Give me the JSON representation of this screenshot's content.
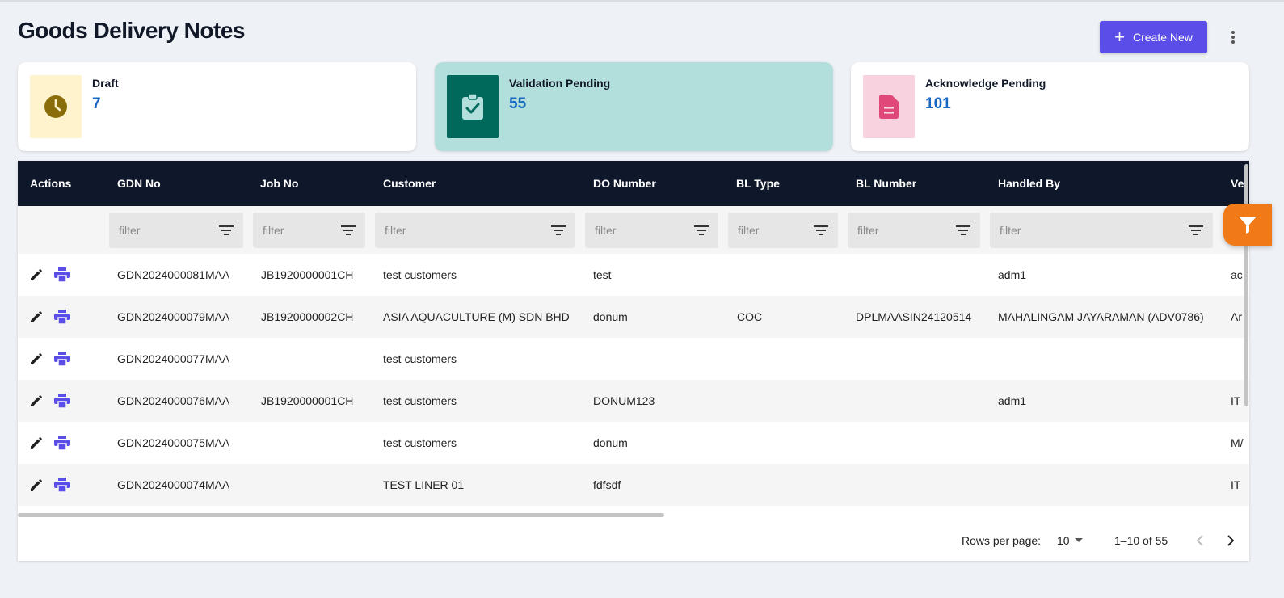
{
  "page": {
    "title": "Goods Delivery Notes"
  },
  "header": {
    "create_label": "Create New"
  },
  "summary_cards": [
    {
      "label": "Draft",
      "count": "7",
      "icon": "clock-icon",
      "icon_bg": "#fff3cd",
      "icon_color": "#8a6d0b"
    },
    {
      "label": "Validation Pending",
      "count": "55",
      "icon": "clipboard-check-icon",
      "icon_bg": "#00695c",
      "icon_color": "#b2dfdb"
    },
    {
      "label": "Acknowledge Pending",
      "count": "101",
      "icon": "document-icon",
      "icon_bg": "#f8d3df",
      "icon_color": "#e0487a"
    }
  ],
  "table": {
    "columns": [
      "Actions",
      "GDN No",
      "Job No",
      "Customer",
      "DO Number",
      "BL Type",
      "BL Number",
      "Handled By",
      "Ve"
    ],
    "filter_placeholder": "filter",
    "rows": [
      {
        "gdn": "GDN2024000081MAA",
        "job": "JB1920000001CH",
        "customer": "test customers",
        "do": "test",
        "bl_type": "",
        "bl_number": "",
        "handled_by": "adm1",
        "ve": "ac"
      },
      {
        "gdn": "GDN2024000079MAA",
        "job": "JB1920000002CH",
        "customer": "ASIA AQUACULTURE (M) SDN BHD",
        "do": "donum",
        "bl_type": "COC",
        "bl_number": "DPLMAASIN24120514",
        "handled_by": "MAHALINGAM JAYARAMAN (ADV0786)",
        "ve": "Ar"
      },
      {
        "gdn": "GDN2024000077MAA",
        "job": "",
        "customer": "test customers",
        "do": "",
        "bl_type": "",
        "bl_number": "",
        "handled_by": "",
        "ve": ""
      },
      {
        "gdn": "GDN2024000076MAA",
        "job": "JB1920000001CH",
        "customer": "test customers",
        "do": "DONUM123",
        "bl_type": "",
        "bl_number": "",
        "handled_by": "adm1",
        "ve": "IT"
      },
      {
        "gdn": "GDN2024000075MAA",
        "job": "",
        "customer": "test customers",
        "do": "donum",
        "bl_type": "",
        "bl_number": "",
        "handled_by": "",
        "ve": "M/"
      },
      {
        "gdn": "GDN2024000074MAA",
        "job": "",
        "customer": "TEST LINER 01",
        "do": "fdfsdf",
        "bl_type": "",
        "bl_number": "",
        "handled_by": "",
        "ve": "IT"
      }
    ]
  },
  "pagination": {
    "rows_per_page_label": "Rows per page:",
    "rows_per_page": "10",
    "range": "1–10 of 55"
  },
  "colors": {
    "accent": "#5b4de8",
    "header_bg": "#0f172a",
    "count": "#1769c4",
    "fab": "#f07a17"
  }
}
